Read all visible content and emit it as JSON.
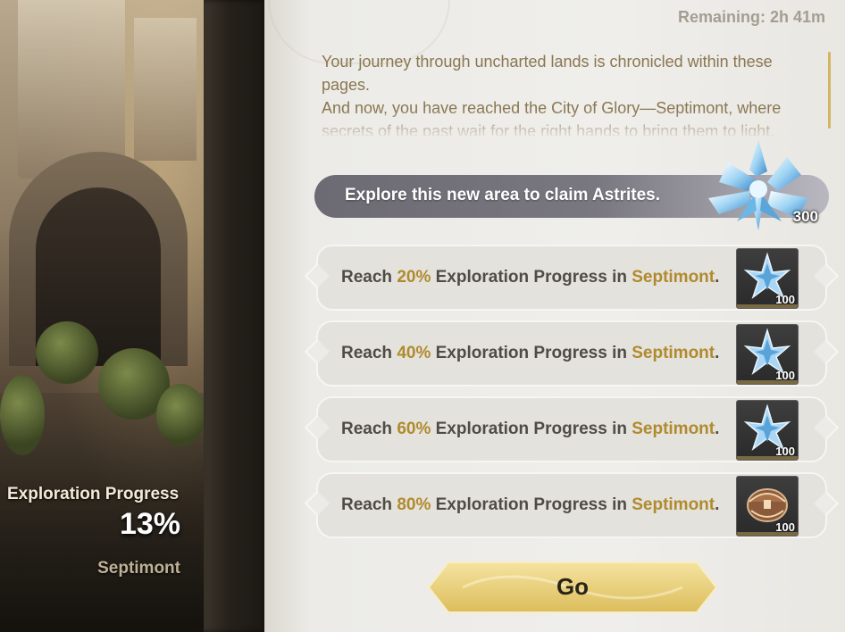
{
  "left_panel": {
    "progress_label": "Exploration Progress",
    "progress_value": "13%",
    "area_name": "Septimont"
  },
  "header": {
    "remaining": "Remaining: 2h 41m"
  },
  "story": {
    "paragraphs": [
      "Your journey through uncharted lands is chronicled within these pages.",
      "And now, you have reached the City of Glory—Septimont, where secrets of the past wait for the right hands to bring them to light."
    ]
  },
  "banner": {
    "text": "Explore this new area to claim Astrites.",
    "reward_icon": "astrite-crystal-icon",
    "reward_count": "300"
  },
  "quests": [
    {
      "prefix": "Reach ",
      "percent": "20%",
      "middle": " Exploration Progress in ",
      "area": "Septimont",
      "suffix": ".",
      "reward_icon": "astrite-icon",
      "reward_amount": "100"
    },
    {
      "prefix": "Reach ",
      "percent": "40%",
      "middle": " Exploration Progress in ",
      "area": "Septimont",
      "suffix": ".",
      "reward_icon": "astrite-icon",
      "reward_amount": "100"
    },
    {
      "prefix": "Reach ",
      "percent": "60%",
      "middle": " Exploration Progress in ",
      "area": "Septimont",
      "suffix": ".",
      "reward_icon": "astrite-icon",
      "reward_amount": "100"
    },
    {
      "prefix": "Reach ",
      "percent": "80%",
      "middle": " Exploration Progress in ",
      "area": "Septimont",
      "suffix": ".",
      "reward_icon": "treasure-chest-icon",
      "reward_amount": "100"
    }
  ],
  "go_button": {
    "label": "Go"
  },
  "colors": {
    "highlight": "#b08a2d",
    "story_text": "#8a7650",
    "button_gold": "#e8cf77"
  }
}
